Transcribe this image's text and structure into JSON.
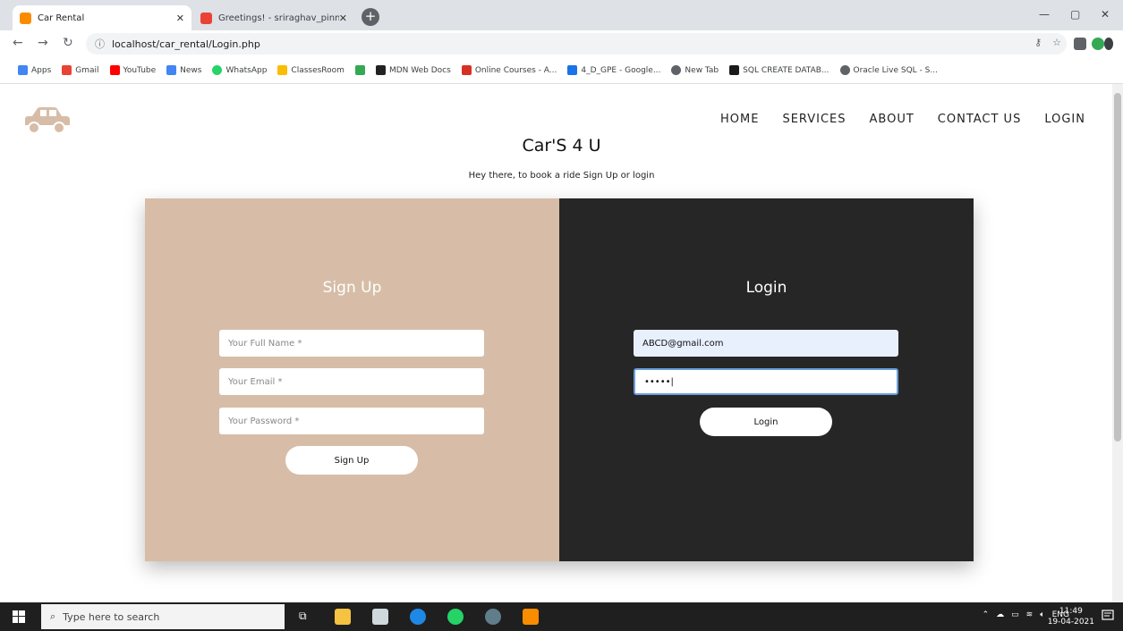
{
  "browser": {
    "tabs": [
      {
        "title": "Car Rental",
        "active": true
      },
      {
        "title": "Greetings! - sriraghav_pinnaka@",
        "active": false
      }
    ],
    "url": "localhost/car_rental/Login.php",
    "bookmarks": [
      {
        "label": "Apps",
        "color": "#4285f4"
      },
      {
        "label": "Gmail",
        "color": "#ea4335"
      },
      {
        "label": "YouTube",
        "color": "#ff0000"
      },
      {
        "label": "News",
        "color": "#4285f4"
      },
      {
        "label": "WhatsApp",
        "color": "#25d366"
      },
      {
        "label": "ClassesRoom",
        "color": "#fbbc04"
      },
      {
        "label": "",
        "color": "#34a853"
      },
      {
        "label": "MDN Web Docs",
        "color": "#222222"
      },
      {
        "label": "Online Courses - A...",
        "color": "#d93025"
      },
      {
        "label": "4_D_GPE - Google...",
        "color": "#1a73e8"
      },
      {
        "label": "New Tab",
        "color": "#5f6368"
      },
      {
        "label": "SQL CREATE DATAB...",
        "color": "#1a1a1a"
      },
      {
        "label": "Oracle Live SQL - S...",
        "color": "#5f6368"
      }
    ]
  },
  "site": {
    "nav": [
      "HOME",
      "SERVICES",
      "ABOUT",
      "CONTACT US",
      "LOGIN"
    ],
    "title": "Car'S 4 U",
    "subtitle": "Hey there, to book a ride Sign Up or login",
    "logo_color": "#d7bda7"
  },
  "signup": {
    "heading": "Sign Up",
    "name_placeholder": "Your Full Name *",
    "email_placeholder": "Your Email *",
    "password_placeholder": "Your Password *",
    "button": "Sign Up",
    "bg_color": "#d7bda7"
  },
  "login": {
    "heading": "Login",
    "email_value": "ABCD@gmail.com",
    "password_value": "•••••|",
    "button": "Login",
    "bg_color": "#262626"
  },
  "taskbar": {
    "search_placeholder": "Type here to search",
    "tray_lang": "ENG",
    "time": "11:49",
    "date": "19-04-2021"
  }
}
